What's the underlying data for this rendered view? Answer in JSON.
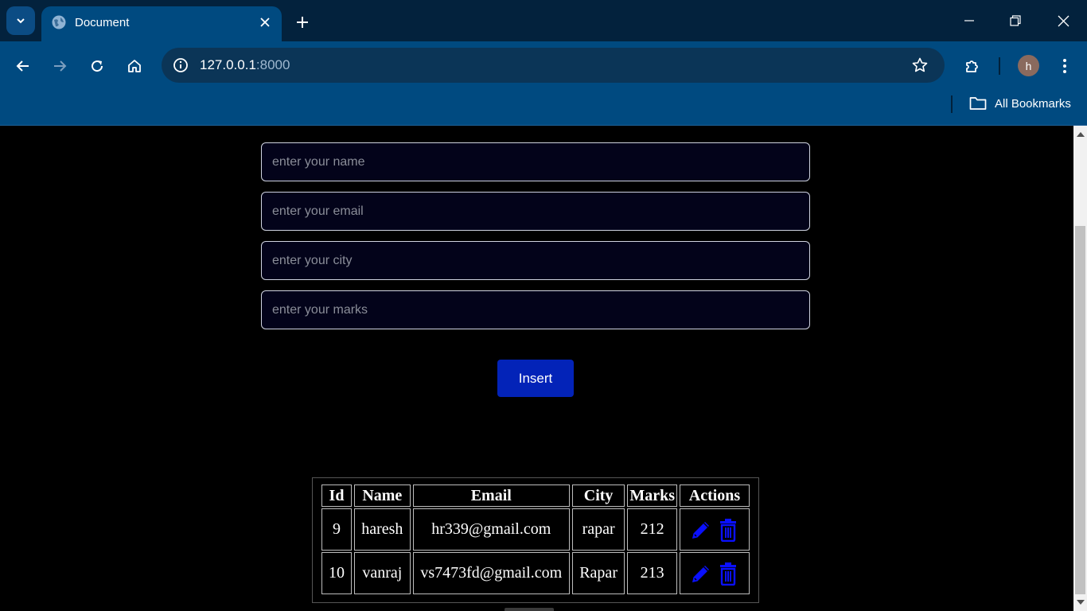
{
  "browser": {
    "tab_title": "Document",
    "url_host": "127.0.0.1",
    "url_port": ":8000",
    "profile_initial": "h",
    "bookmarks_label": "All Bookmarks"
  },
  "form": {
    "name_placeholder": "enter your name",
    "email_placeholder": "enter your email",
    "city_placeholder": "enter your city",
    "marks_placeholder": "enter your marks",
    "insert_label": "Insert"
  },
  "table": {
    "headers": [
      "Id",
      "Name",
      "Email",
      "City",
      "Marks",
      "Actions"
    ],
    "rows": [
      {
        "id": "9",
        "name": "haresh",
        "email": "hr339@gmail.com",
        "city": "rapar",
        "marks": "212"
      },
      {
        "id": "10",
        "name": "vanraj",
        "email": "vs7473fd@gmail.com",
        "city": "Rapar",
        "marks": "213"
      }
    ]
  },
  "colors": {
    "chrome_tabbar": "#03223d",
    "chrome_toolbar": "#004a80",
    "insert_button": "#0323b8",
    "action_icon": "#0a10ff"
  }
}
